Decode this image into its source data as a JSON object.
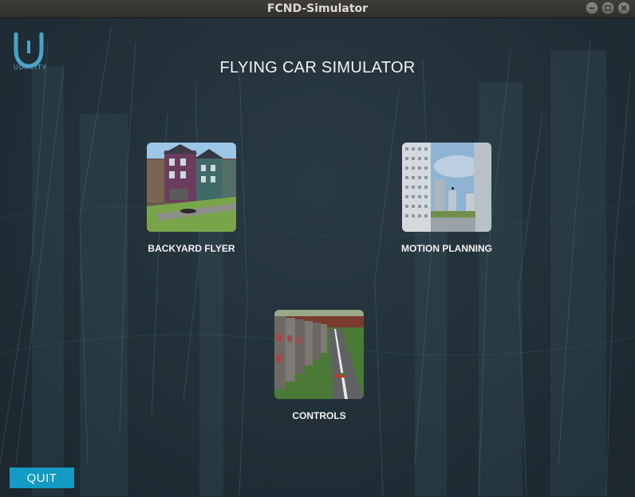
{
  "window": {
    "title": "FCND-Simulator"
  },
  "logo": {
    "text": "UDACITY"
  },
  "main": {
    "heading": "FLYING CAR SIMULATOR",
    "scenarios": [
      {
        "label": "BACKYARD FLYER"
      },
      {
        "label": "MOTION PLANNING"
      },
      {
        "label": "CONTROLS"
      }
    ]
  },
  "footer": {
    "quit_label": "QUIT"
  },
  "colors": {
    "accent": "#139bc3",
    "background": "#1f2b33",
    "text": "#f2f2f2"
  }
}
